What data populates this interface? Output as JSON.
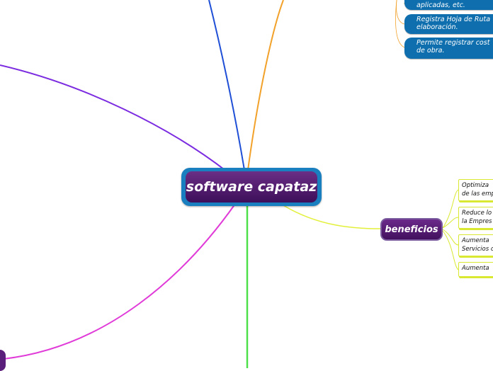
{
  "central_topic": "software capataz",
  "branch": "beneficios",
  "blue_notes": [
    "aplicadas, etc.",
    "Registra Hoja de Ruta\nelaboración.",
    "Permite registrar cost\nde obra."
  ],
  "yellow_notes": [
    "Optimiza\nde las emp",
    "Reduce lo\nla Empres",
    "Aumenta\nServicios c",
    "Aumenta"
  ],
  "colors": {
    "central_fill": "#4a1868",
    "central_border": "#1a7fbf",
    "connector_blue": "#1f4fd6",
    "connector_orange": "#f2a12a",
    "connector_violet": "#7b2be0",
    "connector_magenta": "#e03ad8",
    "connector_green": "#4de04a",
    "connector_yellow": "#e2f03a",
    "note_blue": "#0f6fae",
    "note_yellow_border": "#d9e830"
  }
}
